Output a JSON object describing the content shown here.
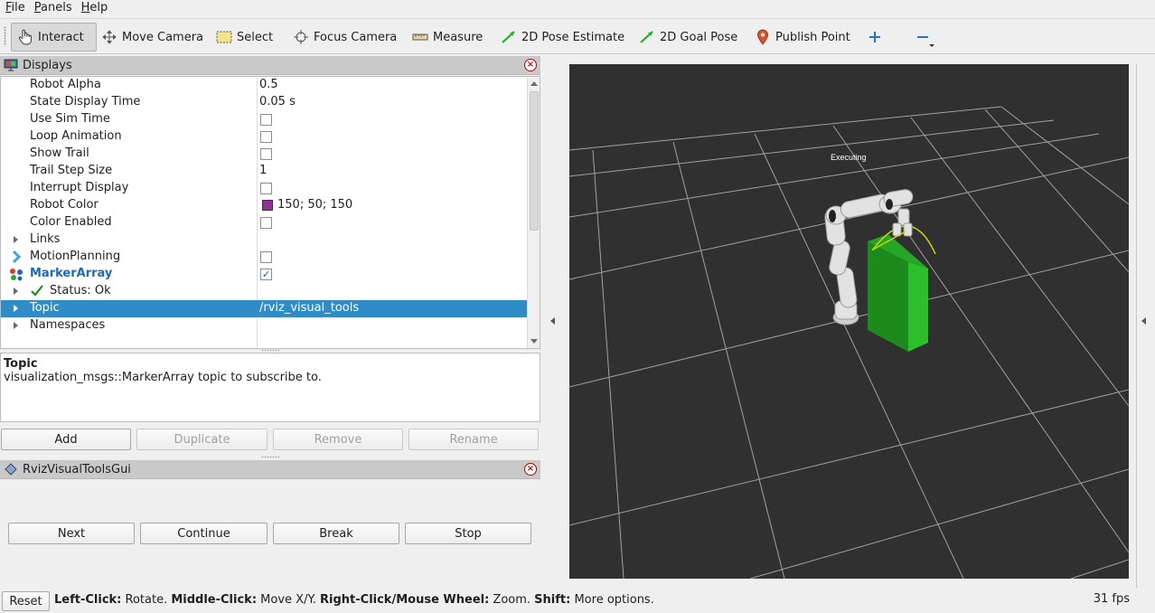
{
  "menubar": {
    "items": [
      {
        "underline": "F",
        "rest": "ile"
      },
      {
        "underline": "P",
        "rest": "anels"
      },
      {
        "underline": "H",
        "rest": "elp"
      }
    ]
  },
  "toolbar": {
    "interact": "Interact",
    "move_camera": "Move Camera",
    "select": "Select",
    "focus_camera": "Focus Camera",
    "measure": "Measure",
    "pose_estimate": "2D Pose Estimate",
    "goal_pose": "2D Goal Pose",
    "publish_point": "Publish Point",
    "add_icon": "plus-icon",
    "remove_icon": "minus-icon"
  },
  "displays": {
    "title": "Displays",
    "rows": [
      {
        "name": "Robot Alpha",
        "value": "0.5"
      },
      {
        "name": "State Display Time",
        "value": "0.05 s"
      },
      {
        "name": "Use Sim Time",
        "checked": false
      },
      {
        "name": "Loop Animation",
        "checked": false
      },
      {
        "name": "Show Trail",
        "checked": false
      },
      {
        "name": "Trail Step Size",
        "value": "1"
      },
      {
        "name": "Interrupt Display",
        "checked": false
      },
      {
        "name": "Robot Color",
        "value": "150; 50; 150",
        "swatch": "#963296"
      },
      {
        "name": "Color Enabled",
        "checked": false
      },
      {
        "name": "Links"
      },
      {
        "name": "MotionPlanning",
        "checked": false
      },
      {
        "name": "MarkerArray",
        "checked": true
      },
      {
        "name": "Status: Ok"
      },
      {
        "name": "Topic",
        "value": "/rviz_visual_tools"
      },
      {
        "name": "Namespaces"
      }
    ]
  },
  "description": {
    "title": "Topic",
    "text": "visualization_msgs::MarkerArray topic to subscribe to."
  },
  "display_buttons": {
    "add": "Add",
    "duplicate": "Duplicate",
    "remove": "Remove",
    "rename": "Rename"
  },
  "rviz_gui": {
    "title": "RvizVisualToolsGui",
    "next": "Next",
    "continue": "Continue",
    "break": "Break",
    "stop": "Stop"
  },
  "viewport": {
    "overlay_text": "Executing",
    "background": "#303030"
  },
  "status": {
    "reset": "Reset",
    "segments": [
      {
        "bold": "Left-Click:",
        "text": " Rotate. "
      },
      {
        "bold": "Middle-Click:",
        "text": " Move X/Y. "
      },
      {
        "bold": "Right-Click/Mouse Wheel:",
        "text": " Zoom. "
      },
      {
        "bold": "Shift:",
        "text": " More options."
      }
    ],
    "fps": "31 fps"
  },
  "colors": {
    "selection": "#308cc6",
    "marker_green": "#1fa91f",
    "link_blue": "#1a6ab8"
  }
}
